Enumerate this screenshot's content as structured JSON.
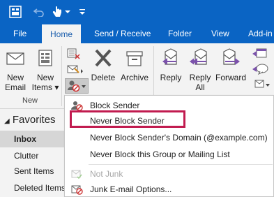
{
  "ribbon_tabs": [
    "File",
    "Home",
    "Send / Receive",
    "Folder",
    "View",
    "Add-in"
  ],
  "ribbon": {
    "new_email": [
      "New",
      "Email"
    ],
    "new_items": [
      "New",
      "Items"
    ],
    "new_group_label": "New",
    "delete": "Delete",
    "archive": "Archive",
    "reply": "Reply",
    "reply_all": [
      "Reply",
      "All"
    ],
    "forward": "Forward"
  },
  "nav": {
    "favorites": "Favorites",
    "items": [
      "Inbox",
      "Clutter",
      "Sent Items",
      "Deleted Items"
    ]
  },
  "junk_menu": {
    "items": [
      {
        "label": "Block Sender",
        "enabled": true
      },
      {
        "label": "Never Block Sender",
        "enabled": true
      },
      {
        "label": "Never Block Sender's Domain (@example.com)",
        "enabled": true
      },
      {
        "label": "Never Block this Group or Mailing List",
        "enabled": true
      },
      {
        "label": "Not Junk",
        "enabled": false
      },
      {
        "label": "Junk E-mail Options...",
        "enabled": true
      }
    ],
    "highlighted_item": "Never Block Sender"
  },
  "colors": {
    "accent": "#0a64c4",
    "highlight_border": "#c11b4f",
    "active_tab_text": "#1c5fad",
    "arrow_purple": "#7b52ab"
  }
}
